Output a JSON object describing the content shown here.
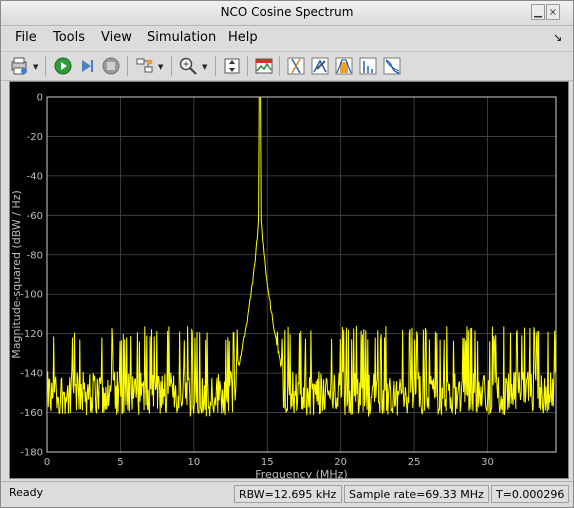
{
  "window": {
    "title": "NCO Cosine Spectrum"
  },
  "menu": [
    "File",
    "Tools",
    "View",
    "Simulation",
    "Help"
  ],
  "toolbar": {
    "icons": [
      "print-icon",
      "run-icon",
      "step-forward-icon",
      "stop-icon",
      "highlight-block-icon",
      "zoom-in-icon",
      "zoom-fit-icon",
      "spectrum-settings-icon",
      "cursor-measurements-icon",
      "peak-finder-icon",
      "channel-measurements-icon",
      "distortion-measurements-icon",
      "ccdf-icon"
    ]
  },
  "chart_data": {
    "type": "line",
    "xlabel": "Frequency (MHz)",
    "ylabel": "Magnitude-squared (dBW / Hz)",
    "xlim": [
      0,
      34.665
    ],
    "ylim": [
      -180,
      0
    ],
    "xticks": [
      0,
      5,
      10,
      15,
      20,
      25,
      30
    ],
    "yticks": [
      0,
      -20,
      -40,
      -60,
      -80,
      -100,
      -120,
      -140,
      -160,
      -180
    ],
    "grid": true,
    "series": [
      {
        "color": "#ffff00",
        "peak": {
          "x": 14.5,
          "y": 0
        },
        "noise_floor_range": [
          -162,
          -118
        ],
        "x": [
          0,
          2,
          4,
          6,
          8,
          10,
          12,
          13,
          13.5,
          14,
          14.3,
          14.5,
          14.7,
          15,
          15.5,
          16,
          17,
          20,
          25,
          30,
          34.665
        ],
        "y": [
          -142,
          -140,
          -141,
          -140,
          -141,
          -140,
          -142,
          -140,
          -130,
          -110,
          -70,
          0,
          -70,
          -110,
          -130,
          -140,
          -141,
          -140,
          -140,
          -141,
          -140
        ]
      }
    ]
  },
  "status": {
    "state": "Ready",
    "rbw": "RBW=12.695 kHz",
    "sample_rate": "Sample rate=69.33 MHz",
    "time": "T=0.000296"
  }
}
